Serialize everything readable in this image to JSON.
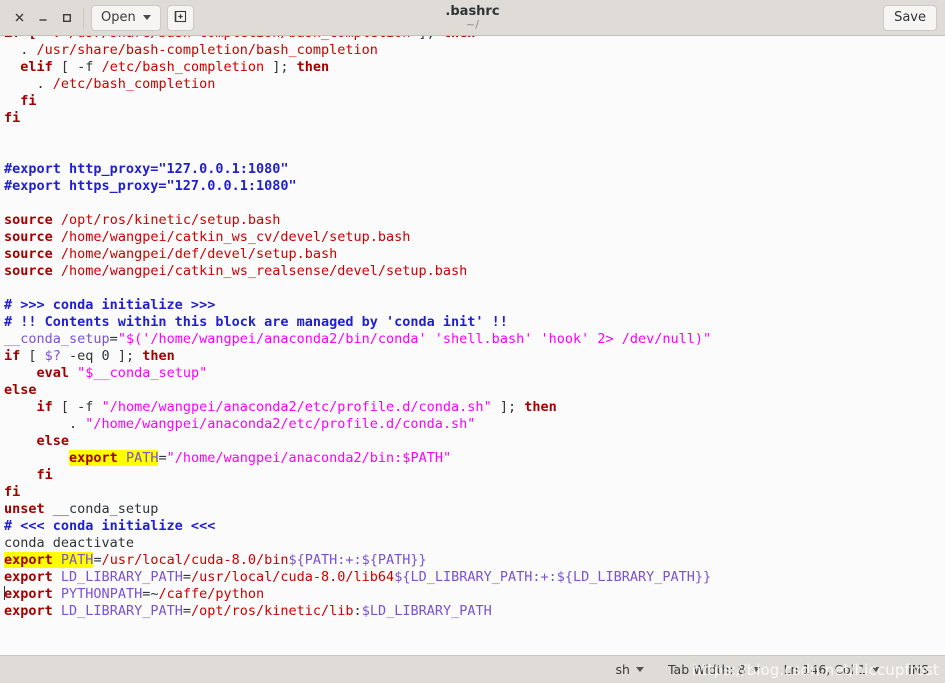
{
  "window": {
    "title": ".bashrc",
    "subtitle": "~/",
    "close_icon": "close-icon",
    "minimize_icon": "minimize-icon",
    "maximize_icon": "maximize-icon"
  },
  "toolbar": {
    "open_label": "Open",
    "new_tab_icon": "new-document-icon",
    "save_label": "Save"
  },
  "statusbar": {
    "language": "sh",
    "tab_width": "Tab Width: 8",
    "position": "Ln 146, Col 1",
    "insert_mode": "INS",
    "watermark": "https://blog.csdn.net/hiccupfrost"
  },
  "colors": {
    "keyword": "#a40000",
    "path": "#cc0000",
    "comment": "#2020d0",
    "variable": "#7a52d1",
    "string": "#ff00ff",
    "highlight": "#ffff00",
    "header_bg": "#dfdcd8",
    "editor_bg": "#fbfbfb"
  },
  "editor": {
    "lines": [
      [
        {
          "t": "if [ -f ",
          "c": "kw"
        },
        {
          "t": "/usr/share/bash-completion/bash_completion",
          "c": "pth"
        },
        {
          "t": " ]; ",
          "c": "plain"
        },
        {
          "t": "then",
          "c": "kw"
        }
      ],
      [
        {
          "t": "  . ",
          "c": "plain"
        },
        {
          "t": "/usr/share/bash-completion/bash_completion",
          "c": "pth"
        }
      ],
      [
        {
          "t": "  ",
          "c": "plain"
        },
        {
          "t": "elif",
          "c": "kw"
        },
        {
          "t": " [ -f ",
          "c": "plain"
        },
        {
          "t": "/etc/bash_completion",
          "c": "pth"
        },
        {
          "t": " ]; ",
          "c": "plain"
        },
        {
          "t": "then",
          "c": "kw"
        }
      ],
      [
        {
          "t": "    . ",
          "c": "plain"
        },
        {
          "t": "/etc/bash_completion",
          "c": "pth"
        }
      ],
      [
        {
          "t": "  ",
          "c": "plain"
        },
        {
          "t": "fi",
          "c": "kw"
        }
      ],
      [
        {
          "t": "fi",
          "c": "kw"
        }
      ],
      [],
      [],
      [
        {
          "t": "#export http_proxy=\"127.0.0.1:1080\"",
          "c": "cmt"
        }
      ],
      [
        {
          "t": "#export https_proxy=\"127.0.0.1:1080\"",
          "c": "cmt"
        }
      ],
      [],
      [
        {
          "t": "source",
          "c": "kw"
        },
        {
          "t": " ",
          "c": "plain"
        },
        {
          "t": "/opt/ros/kinetic/setup.bash",
          "c": "pth"
        }
      ],
      [
        {
          "t": "source",
          "c": "kw"
        },
        {
          "t": " ",
          "c": "plain"
        },
        {
          "t": "/home/wangpei/catkin_ws_cv/devel/setup.bash",
          "c": "pth"
        }
      ],
      [
        {
          "t": "source",
          "c": "kw"
        },
        {
          "t": " ",
          "c": "plain"
        },
        {
          "t": "/home/wangpei/def/devel/setup.bash",
          "c": "pth"
        }
      ],
      [
        {
          "t": "source",
          "c": "kw"
        },
        {
          "t": " ",
          "c": "plain"
        },
        {
          "t": "/home/wangpei/catkin_ws_realsense/devel/setup.bash",
          "c": "pth"
        }
      ],
      [],
      [
        {
          "t": "# >>> conda initialize >>>",
          "c": "cmt"
        }
      ],
      [
        {
          "t": "# !! Contents within this block are managed by 'conda init' !!",
          "c": "cmt"
        }
      ],
      [
        {
          "t": "__conda_setup",
          "c": "var"
        },
        {
          "t": "=",
          "c": "plain"
        },
        {
          "t": "\"$('/home/wangpei/anaconda2/bin/conda' 'shell.bash' 'hook' 2> /dev/null)\"",
          "c": "str"
        }
      ],
      [
        {
          "t": "if",
          "c": "kw"
        },
        {
          "t": " [ ",
          "c": "plain"
        },
        {
          "t": "$?",
          "c": "var"
        },
        {
          "t": " -eq 0 ]; ",
          "c": "plain"
        },
        {
          "t": "then",
          "c": "kw"
        }
      ],
      [
        {
          "t": "    ",
          "c": "plain"
        },
        {
          "t": "eval",
          "c": "kw"
        },
        {
          "t": " ",
          "c": "plain"
        },
        {
          "t": "\"$__conda_setup\"",
          "c": "str"
        }
      ],
      [
        {
          "t": "else",
          "c": "kw"
        }
      ],
      [
        {
          "t": "    ",
          "c": "plain"
        },
        {
          "t": "if",
          "c": "kw"
        },
        {
          "t": " [ -f ",
          "c": "plain"
        },
        {
          "t": "\"/home/wangpei/anaconda2/etc/profile.d/conda.sh\"",
          "c": "str"
        },
        {
          "t": " ]; ",
          "c": "plain"
        },
        {
          "t": "then",
          "c": "kw"
        }
      ],
      [
        {
          "t": "        . ",
          "c": "plain"
        },
        {
          "t": "\"/home/wangpei/anaconda2/etc/profile.d/conda.sh\"",
          "c": "str"
        }
      ],
      [
        {
          "t": "    ",
          "c": "plain"
        },
        {
          "t": "else",
          "c": "kw"
        }
      ],
      [
        {
          "t": "        ",
          "c": "plain"
        },
        {
          "t": "export",
          "c": "kw hl"
        },
        {
          "t": " ",
          "c": "plain hl"
        },
        {
          "t": "PATH",
          "c": "var hl"
        },
        {
          "t": "=",
          "c": "plain"
        },
        {
          "t": "\"/home/wangpei/anaconda2/bin:$PATH\"",
          "c": "str"
        }
      ],
      [
        {
          "t": "    ",
          "c": "plain"
        },
        {
          "t": "fi",
          "c": "kw"
        }
      ],
      [
        {
          "t": "fi",
          "c": "kw"
        }
      ],
      [
        {
          "t": "unset",
          "c": "kw"
        },
        {
          "t": " __conda_setup",
          "c": "plain"
        }
      ],
      [
        {
          "t": "# <<< conda initialize <<<",
          "c": "cmt"
        }
      ],
      [
        {
          "t": "conda deactivate",
          "c": "plain"
        }
      ],
      [
        {
          "t": "export",
          "c": "kw hl"
        },
        {
          "t": " ",
          "c": "plain hl"
        },
        {
          "t": "PATH",
          "c": "var hl"
        },
        {
          "t": "=",
          "c": "plain"
        },
        {
          "t": "/usr/local/cuda-8.0/bin",
          "c": "pth"
        },
        {
          "t": "${PATH:+:${PATH}}",
          "c": "var"
        }
      ],
      [
        {
          "t": "export",
          "c": "kw"
        },
        {
          "t": " ",
          "c": "plain"
        },
        {
          "t": "LD_LIBRARY_PATH",
          "c": "var"
        },
        {
          "t": "=",
          "c": "plain"
        },
        {
          "t": "/usr/local/cuda-8.0/lib64",
          "c": "pth"
        },
        {
          "t": "${LD_LIBRARY_PATH:+:${LD_LIBRARY_PATH}}",
          "c": "var"
        }
      ],
      [
        {
          "t": "export",
          "c": "kw",
          "cursor": true
        },
        {
          "t": " ",
          "c": "plain"
        },
        {
          "t": "PYTHONPATH",
          "c": "var"
        },
        {
          "t": "=~",
          "c": "plain"
        },
        {
          "t": "/caffe/python",
          "c": "pth"
        }
      ],
      [
        {
          "t": "export",
          "c": "kw"
        },
        {
          "t": " ",
          "c": "plain"
        },
        {
          "t": "LD_LIBRARY_PATH",
          "c": "var"
        },
        {
          "t": "=",
          "c": "plain"
        },
        {
          "t": "/opt/ros/kinetic/lib",
          "c": "pth"
        },
        {
          "t": ":",
          "c": "plain"
        },
        {
          "t": "$LD_LIBRARY_PATH",
          "c": "var"
        }
      ]
    ]
  }
}
